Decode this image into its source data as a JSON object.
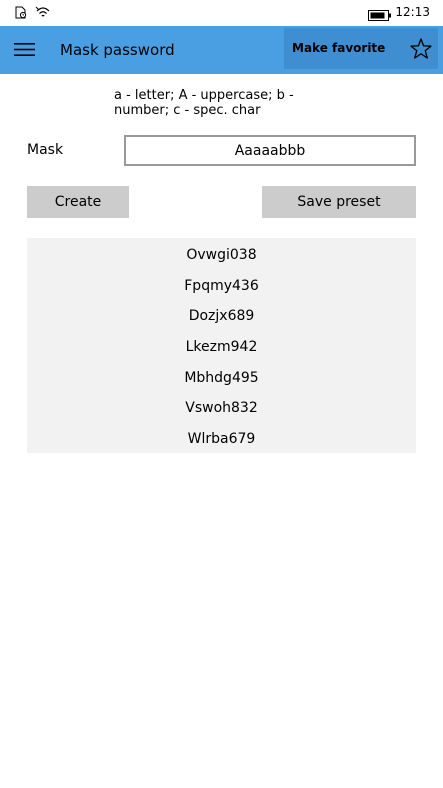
{
  "status_bar": {
    "time": "12:13",
    "icons": [
      "missed-call-icon",
      "wifi-icon",
      "battery-icon"
    ]
  },
  "app_bar": {
    "menu_icon": "hamburger-menu-icon",
    "title": "Mask password",
    "favorite_label": "Make favorite",
    "favorite_icon": "star-outline-icon",
    "color": "#4a9fe3",
    "favorite_bg": "#3f8ed1"
  },
  "form": {
    "hint": "a - letter; A - uppercase; b - number; c - spec. char",
    "mask_label": "Mask",
    "mask_value": "Aaaaabbb",
    "create_label": "Create",
    "save_preset_label": "Save preset"
  },
  "results": [
    "Ovwgi038",
    "Fpqmy436",
    "Dozjx689",
    "Lkezm942",
    "Mbhdg495",
    "Vswoh832",
    "Wlrba679"
  ]
}
